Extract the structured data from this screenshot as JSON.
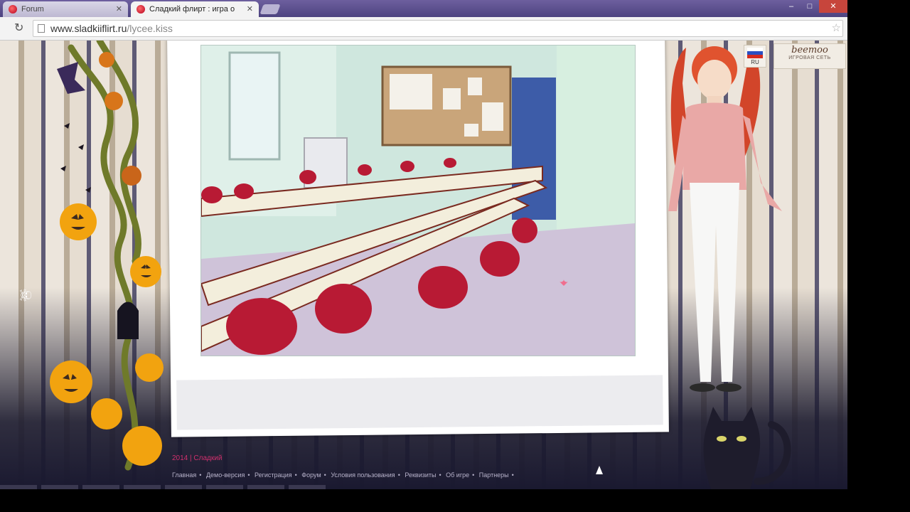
{
  "browser": {
    "tabs": [
      {
        "label": "Forum",
        "active": false
      },
      {
        "label": "Сладкий флирт : игра о",
        "active": true
      }
    ],
    "window_buttons": [
      "–",
      "□",
      "✕"
    ],
    "url": {
      "host": "www.sladkiiflirt.ru",
      "path": "/lycee.kiss"
    }
  },
  "header": {
    "lang_label": "RU",
    "network_brand": "beemoo",
    "network_tagline": "ИГРОВАЯ СЕТЬ"
  },
  "footer": {
    "copyright": "2014 | Сладкий",
    "links": [
      "Главная",
      "Демо-версия",
      "Регистрация",
      "Форум",
      "Условия пользования",
      "Реквизиты",
      "Об игре",
      "Партнеры"
    ],
    "separator": "•"
  },
  "colors": {
    "accent_pink": "#d2306e",
    "chair_red": "#b81a34"
  }
}
